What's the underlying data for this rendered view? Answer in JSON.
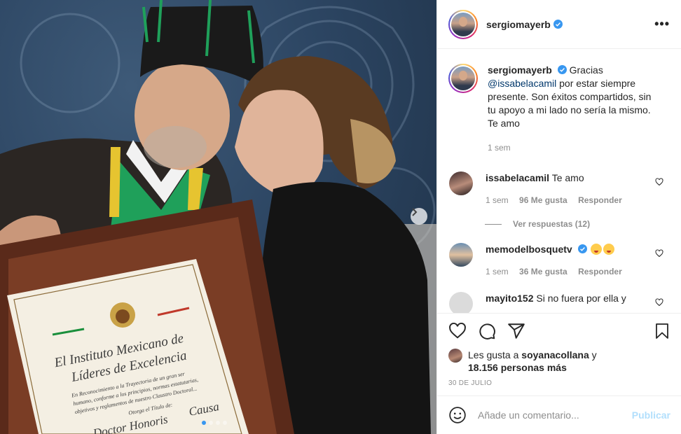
{
  "post": {
    "username": "sergiomayerb",
    "more_label": "•••",
    "caption_prefix": "Gracias",
    "caption_mention": "@issabelacamil",
    "caption_rest": "por estar siempre presente. Son éxitos compartidos, sin tu apoyo a mi lado no sería la mismo. Te amo",
    "caption_time": "1 sem"
  },
  "certificate": {
    "line1": "El Instituto Mexicano de",
    "line2": "Líderes de Excelencia",
    "small1": "En Reconocimiento a la Trayectoria de un gran ser",
    "small2": "humano, conforme a los principios, normas estatutarias,",
    "small3": "objetivos y reglamentos de nuestro Claustro Doctoral...",
    "small4": "Otorga el Título de:",
    "title1": "Doctor Honoris",
    "title2": "Causa"
  },
  "comments": [
    {
      "username": "issabelacamil",
      "text": "Te amo",
      "time": "1 sem",
      "likes": "96 Me gusta",
      "reply": "Responder",
      "view_replies": "Ver respuestas (12)"
    },
    {
      "username": "memodelbosquetv",
      "text": "",
      "time": "1 sem",
      "likes": "36 Me gusta",
      "reply": "Responder"
    },
    {
      "username": "mayito152",
      "text": "Si no fuera por ella y"
    }
  ],
  "likes_line": {
    "prefix": "Les gusta a",
    "user": "soyanacollana",
    "conj": "y",
    "count": "18.156 personas más"
  },
  "date": "30 DE JULIO",
  "add_comment": {
    "placeholder": "Añade un comentario...",
    "post_label": "Publicar"
  },
  "colors": {
    "verified": "#3897f0",
    "link": "#00376b",
    "muted": "#8e8e8e",
    "post_disabled": "#b2dffc"
  }
}
